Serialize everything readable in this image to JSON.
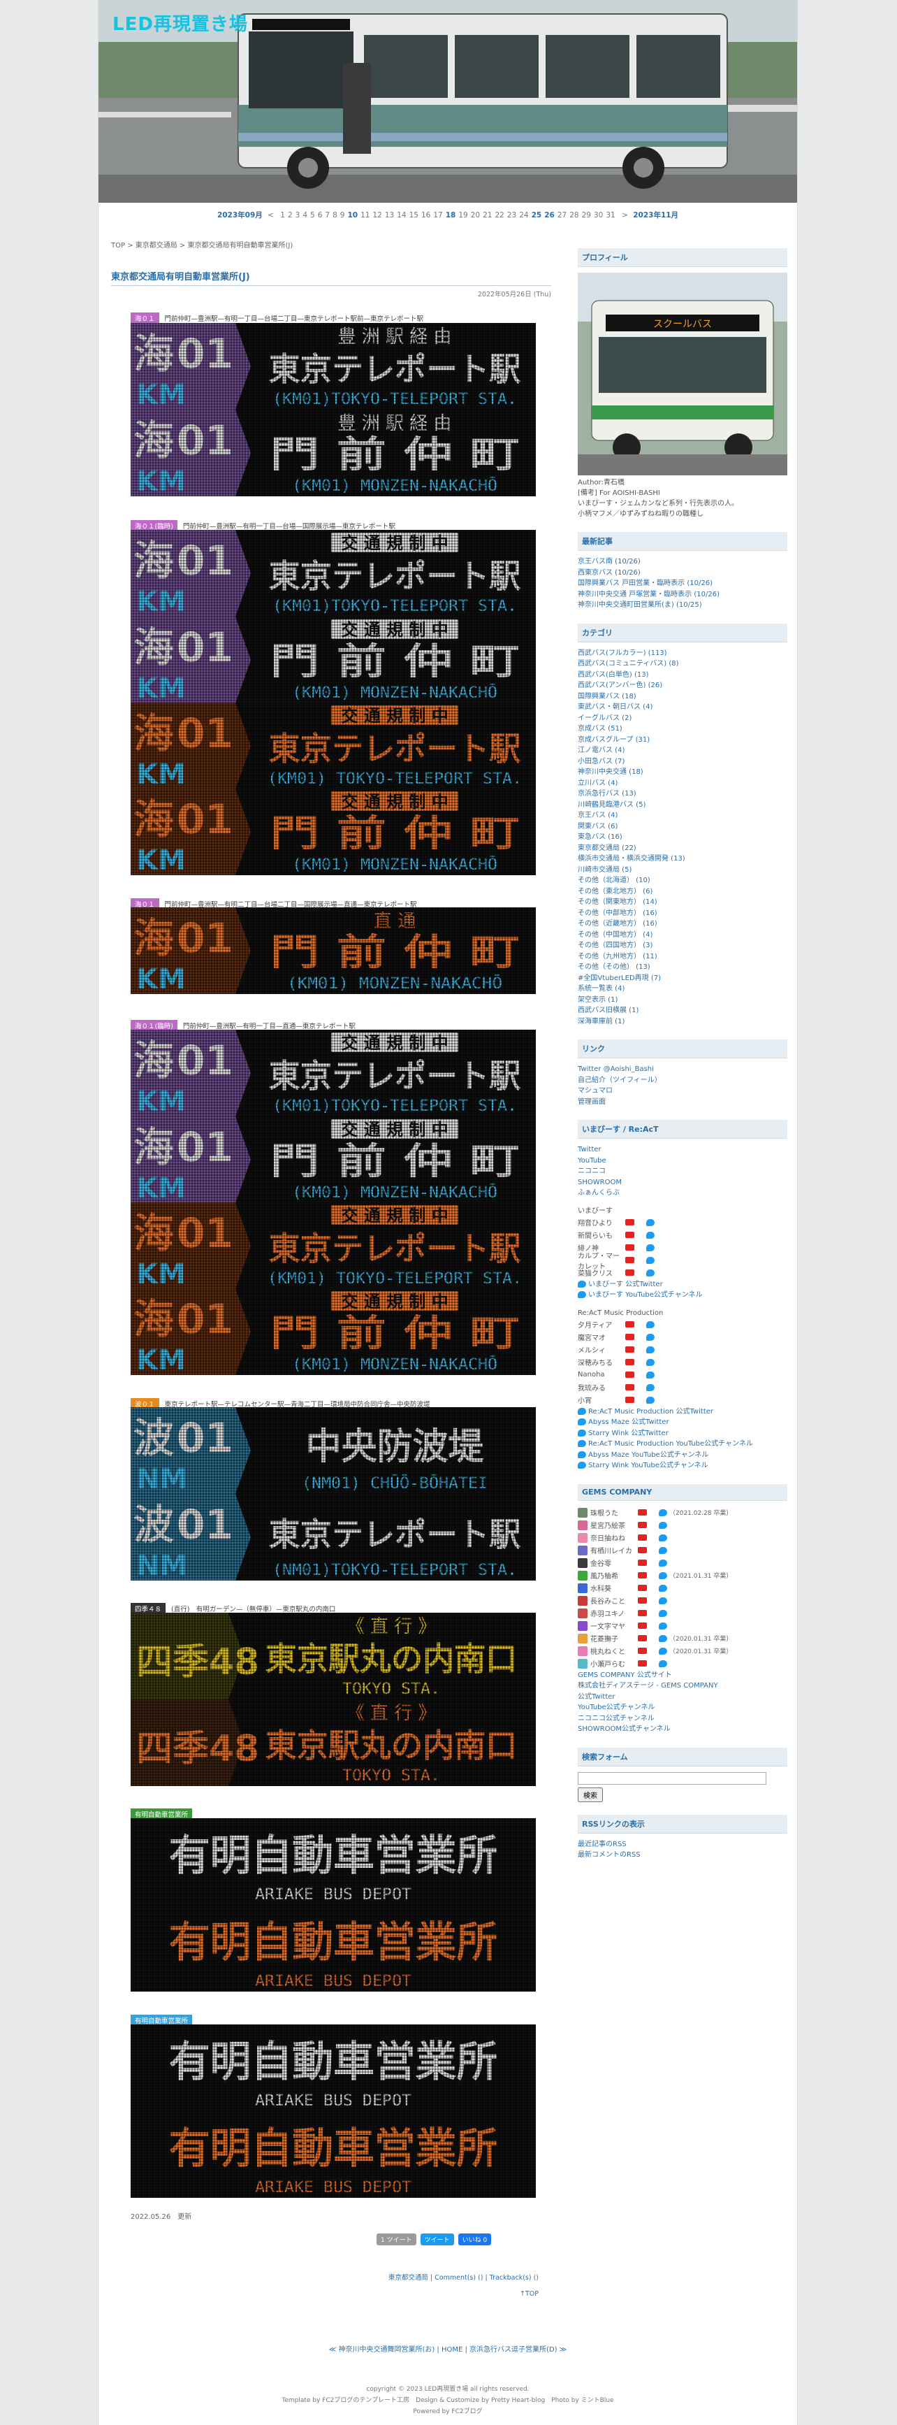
{
  "site": {
    "title": "LED再現置き場"
  },
  "calendar": {
    "prev": "2023年09月",
    "next": "2023年11月",
    "days": [
      "1",
      "2",
      "3",
      "4",
      "5",
      "6",
      "7",
      "8",
      "9",
      "10",
      "11",
      "12",
      "13",
      "14",
      "15",
      "16",
      "17",
      "18",
      "19",
      "20",
      "21",
      "22",
      "23",
      "24",
      "25",
      "26",
      "27",
      "28",
      "29",
      "30",
      "31"
    ],
    "highlighted": [
      "10",
      "18",
      "25",
      "26"
    ]
  },
  "breadcrumb": "TOP > 東京都交通局 > 東京都交通局有明自動車営業所(J)",
  "post": {
    "title": "東京都交通局有明自動車営業所(J)",
    "date": "2022年05月26日 (Thu)",
    "captions": [
      {
        "tag": "海０１",
        "tag_color": "#c068c8",
        "text": "門前仲町—豊洲駅—有明一丁目—台場二丁目—東京テレポート駅前—東京テレポート駅"
      },
      {
        "tag": "海０１(臨時)",
        "tag_color": "#c068c8",
        "text": "門前仲町—豊洲駅—有明一丁目—台場—国際展示場—東京テレポート駅"
      },
      {
        "tag": "海０１",
        "tag_color": "#c068c8",
        "text": "門前仲町—豊洲駅—有明二丁目—台場二丁目—国際展示場—直通—東京テレポート駅"
      },
      {
        "tag": "海０１(臨時)",
        "tag_color": "#c068c8",
        "text": "門前仲町—豊洲駅—有明一丁目—直通—東京テレポート駅"
      },
      {
        "tag": "波０１",
        "tag_color": "#e88a20",
        "text": "東京テレポート駅—テレコムセンター駅—青海二丁目—環境局中防合同庁舎—中央防波堤"
      },
      {
        "tag": "四季４８",
        "tag_color": "#333",
        "text": "(直行)　有明ガーデン—（無停車）—東京駅丸の内南口"
      },
      {
        "tag": "有明自動車営業所",
        "tag_color": "#3a9a3a",
        "text": ""
      },
      {
        "tag": "有明自動車営業所",
        "tag_color": "#3aa0d8",
        "text": ""
      }
    ],
    "boards": [
      {
        "route": "海",
        "num": "01",
        "code": "KM",
        "top": "豊 洲 駅 経 由",
        "main": "東京テレポート駅",
        "sub": "(KM01)TOKYO-TELEPORT STA.",
        "color": "#e0e0e0",
        "band": "#6a4a8a"
      },
      {
        "route": "海",
        "num": "01",
        "code": "KM",
        "top": "豊 洲 駅 経 由",
        "main": "門 前 仲 町",
        "sub": "(KM01) MONZEN-NAKACHŌ",
        "color": "#e0e0e0",
        "band": "#6a4a8a"
      },
      {
        "route": "海",
        "num": "01",
        "code": "KM",
        "top": "交 通 規 制 中",
        "main": "東京テレポート駅",
        "sub": "(KM01)TOKYO-TELEPORT STA.",
        "color": "#e0e0e0",
        "band": "#6a4a8a"
      },
      {
        "route": "海",
        "num": "01",
        "code": "KM",
        "top": "交 通 規 制 中",
        "main": "門 前 仲 町",
        "sub": "(KM01) MONZEN-NAKACHŌ",
        "color": "#e0e0e0",
        "band": "#6a4a8a"
      },
      {
        "route": "海",
        "num": "01",
        "code": "KM",
        "top": "交 通 規 制 中",
        "main": "東京テレポート駅",
        "sub": "(KM01) TOKYO-TELEPORT STA.",
        "color": "#e8702a",
        "band": "#5a2a10"
      },
      {
        "route": "海",
        "num": "01",
        "code": "KM",
        "top": "交 通 規 制 中",
        "main": "門 前 仲 町",
        "sub": "(KM01) MONZEN-NAKACHŌ",
        "color": "#e8702a",
        "band": "#5a2a10"
      },
      {
        "route": "海",
        "num": "01",
        "code": "KM",
        "top": "直 通",
        "main": "門 前 仲 町",
        "sub": "(KM01)  MONZEN-NAKACHŌ",
        "color": "#e8702a",
        "band": "#5a2a10"
      },
      {
        "route": "海",
        "num": "01",
        "code": "KM",
        "top": "交 通 規 制 中",
        "main": "東京テレポート駅",
        "sub": "(KM01)TOKYO-TELEPORT STA.",
        "color": "#e0e0e0",
        "band": "#6a4a8a"
      },
      {
        "route": "海",
        "num": "01",
        "code": "KM",
        "top": "交 通 規 制 中",
        "main": "門 前 仲 町",
        "sub": "(KM01) MONZEN-NAKACHŌ",
        "color": "#e0e0e0",
        "band": "#6a4a8a"
      },
      {
        "route": "海",
        "num": "01",
        "code": "KM",
        "top": "交 通 規 制 中",
        "main": "東京テレポート駅",
        "sub": "(KM01) TOKYO-TELEPORT STA.",
        "color": "#e8702a",
        "band": "#5a2a10"
      },
      {
        "route": "海",
        "num": "01",
        "code": "KM",
        "top": "交 通 規 制 中",
        "main": "門 前 仲 町",
        "sub": "(KM01) MONZEN-NAKACHŌ",
        "color": "#e8702a",
        "band": "#5a2a10"
      },
      {
        "route": "波",
        "num": "01",
        "code": "NM",
        "top": "",
        "main": "中央防波堤",
        "sub": "(NM01) CHŪŌ-BŌHATEI",
        "color": "#e0e0e0",
        "band": "#2a6a8a"
      },
      {
        "route": "波",
        "num": "01",
        "code": "NM",
        "top": "",
        "main": "東京テレポート駅",
        "sub": "(NM01)TOKYO-TELEPORT STA.",
        "color": "#e0e0e0",
        "band": "#2a6a8a"
      },
      {
        "route": "四季",
        "num": "48",
        "code": "",
        "top": "《 直 行 》",
        "main": "東京駅丸の内南口",
        "sub": "TOKYO STA.",
        "color": "#e0c020",
        "band": "#3a3a10"
      },
      {
        "route": "四季",
        "num": "48",
        "code": "",
        "top": "《 直 行 》",
        "main": "東京駅丸の内南口",
        "sub": "TOKYO STA.",
        "color": "#e8702a",
        "band": "#3a2010"
      },
      {
        "route": "",
        "num": "",
        "code": "",
        "top": "",
        "main": "有明自動車営業所",
        "sub": "ARIAKE BUS DEPOT",
        "color": "#e0e0e0",
        "band": "#2a5a2a"
      },
      {
        "route": "",
        "num": "",
        "code": "",
        "top": "",
        "main": "有明自動車営業所",
        "sub": "ARIAKE BUS DEPOT",
        "color": "#e8702a",
        "band": "#2a1a10"
      },
      {
        "route": "",
        "num": "",
        "code": "",
        "top": "",
        "main": "有明自動車営業所",
        "sub": "ARIAKE BUS DEPOT",
        "color": "#e0e0e0",
        "band": "#1a4a6a"
      },
      {
        "route": "",
        "num": "",
        "code": "",
        "top": "",
        "main": "有明自動車営業所",
        "sub": "ARIAKE BUS DEPOT",
        "color": "#e8702a",
        "band": "#2a1a10"
      }
    ],
    "footer_date": "2022.05.26　更新",
    "share": [
      "1 ツイート",
      "ツイート",
      "いいね 0"
    ],
    "meta": "東京都交通局 | Comment(s) () | Trackback(s) ()",
    "top_link": "↑TOP"
  },
  "sidebar": {
    "profile": {
      "heading": "プロフィール",
      "lines": [
        "Author:青石橋",
        "[備考] For AOISHI-BASHI",
        "いまびーす・ジェムカンなど系列・行先表示の人。",
        "小柄マフメ／ゆずみずねね暇りの職種し"
      ]
    },
    "recent": {
      "heading": "最新記事",
      "items": [
        "京王バス南 (10/26)",
        "西東京バス (10/26)",
        "国際興業バス 戸田営業・臨時表示 (10/26)",
        "神奈川中央交通 戸塚営業・臨時表示 (10/26)",
        "神奈川中央交通町田営業所(ま) (10/25)"
      ]
    },
    "category": {
      "heading": "カテゴリ",
      "items": [
        "西武バス(フルカラー) (113)",
        "西武バス(コミュニティバス) (8)",
        "西武バス(白単色) (13)",
        "西武バス(アンバー色) (26)",
        "国際興業バス (18)",
        "東武バス・朝日バス (4)",
        "イーグルバス (2)",
        "京成バス (51)",
        "京成バスグループ (31)",
        "江ノ電バス (4)",
        "小田急バス (7)",
        "神奈川中央交通 (18)",
        "立川バス (4)",
        "京浜急行バス (13)",
        "川崎鶴見臨港バス (5)",
        "京王バス (4)",
        "関東バス (6)",
        "東急バス (16)",
        "東京都交通局 (22)",
        "横浜市交通局・横浜交通開発 (13)",
        "川崎市交通局 (5)",
        "その他（北海道） (10)",
        "その他（東北地方） (6)",
        "その他（関東地方） (14)",
        "その他（中部地方） (16)",
        "その他（近畿地方） (16)",
        "その他（中国地方） (4)",
        "その他（四国地方） (3)",
        "その他（九州地方） (11)",
        "その他（その他） (13)",
        "#全国VtuberLED再現 (7)",
        "系統一覧表 (4)",
        "架空表示 (1)",
        "西武バス旧横展 (1)",
        "深海車庫前 (1)"
      ]
    },
    "links": {
      "heading": "リンク",
      "items": [
        "Twitter @Aoishi_Bashi",
        "自己紹介（ツイフィール）",
        "マシュマロ",
        "管理画面"
      ]
    },
    "imaseeds": {
      "heading": "いまびーす / Re:AcT",
      "head_items": [
        "Twitter",
        "YouTube",
        "ニコニコ",
        "SHOWROOM",
        "ふぁんくらぶ"
      ],
      "group1_title": "いまびーす",
      "group1": [
        "翔音ひより",
        "新間らいも",
        "緋ノ神",
        "カルプ・マーカレット",
        "菜猫クリス"
      ],
      "official1": [
        "いまびーす 公式Twitter",
        "いまびーす YouTube公式チャンネル"
      ],
      "group2_title": "Re:AcT Music Production",
      "group2": [
        "夕月ティア",
        "魔宮マオ",
        "メルシィ",
        "深穂みちる",
        "Nanoha",
        "我琉みる",
        "小宵"
      ],
      "official2": [
        "Re:AcT Music Production 公式Twitter",
        "Abyss Maze 公式Twitter",
        "Starry Wink 公式Twitter",
        "Re:AcT Music Production YouTube公式チャンネル",
        "Abyss Maze YouTube公式チャンネル",
        "Starry Wink YouTube公式チャンネル"
      ]
    },
    "gems": {
      "heading": "GEMS COMPANY",
      "members": [
        {
          "name": "珠根うた",
          "note": "（2021.02.28 卒業）",
          "color": "#6a8a6a"
        },
        {
          "name": "星宮乃絵茶",
          "note": "",
          "color": "#d86a9a"
        },
        {
          "name": "奈日抽ねね",
          "note": "",
          "color": "#e88aa8"
        },
        {
          "name": "有栖川レイカ",
          "note": "",
          "color": "#6a6ac8"
        },
        {
          "name": "金谷零",
          "note": "",
          "color": "#3a3a3a"
        },
        {
          "name": "風乃柚希",
          "note": "（2021.01.31 卒業）",
          "color": "#3aa83a"
        },
        {
          "name": "水科葵",
          "note": "",
          "color": "#3a6ad8"
        },
        {
          "name": "長谷みこと",
          "note": "",
          "color": "#c83a3a"
        },
        {
          "name": "赤羽ユキノ",
          "note": "",
          "color": "#c84a4a"
        },
        {
          "name": "一文字マヤ",
          "note": "",
          "color": "#8a4ac8"
        },
        {
          "name": "花菱撫子",
          "note": "（2020.01.31 卒業）",
          "color": "#e8a03a"
        },
        {
          "name": "桃丸ねくと",
          "note": "（2020.01.31 卒業）",
          "color": "#e87ab8"
        },
        {
          "name": "小瀬戸らむ",
          "note": "",
          "color": "#58b8c8"
        }
      ],
      "links": [
        "GEMS COMPANY 公式サイト",
        "株式会社ディアステージ - GEMS COMPANY",
        "公式Twitter",
        "YouTube公式チャンネル",
        "ニコニコ公式チャンネル",
        "SHOWROOM公式チャンネル"
      ]
    },
    "search": {
      "heading": "検索フォーム",
      "button": "検索"
    },
    "rss": {
      "heading": "RSSリンクの表示",
      "items": [
        "最近記事のRSS",
        "最新コメントのRSS"
      ]
    }
  },
  "nav": "≪ 神奈川中央交通舞岡営業所(お) | HOME | 京浜急行バス逗子営業所(D) ≫",
  "footer": [
    "copyright © 2023 LED再現置き場 all rights reserved.",
    "Template by FC2ブログのテンプレート工房　Design & Customize by Pretty Heart-blog　Photo by ミントBlue",
    "Powered by FC2ブログ"
  ]
}
